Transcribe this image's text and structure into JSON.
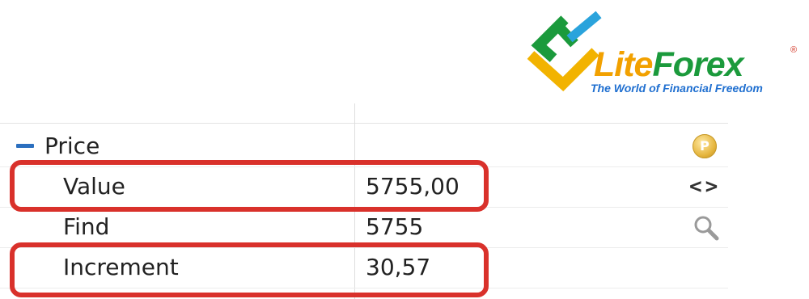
{
  "logo": {
    "name_part1": "Lite",
    "name_part2": "Forex",
    "registered": "®",
    "tagline": "The World of Financial Freedom",
    "colors": {
      "yellow": "#f2a100",
      "green": "#1b9a3c",
      "blue": "#1f6fd0"
    }
  },
  "grid": {
    "group": {
      "label": "Price",
      "collapse_symbol": "−",
      "icon": "coin-p-icon",
      "icon_text": "P"
    },
    "rows": [
      {
        "label": "Value",
        "value": "5755,00",
        "icon": "arrows-icon",
        "icon_text": "<>"
      },
      {
        "label": "Find",
        "value": "5755",
        "icon": "search-icon"
      },
      {
        "label": "Increment",
        "value": "30,57"
      }
    ]
  },
  "highlights": {
    "color": "#d9312b",
    "rows": [
      "Value",
      "Increment"
    ]
  }
}
